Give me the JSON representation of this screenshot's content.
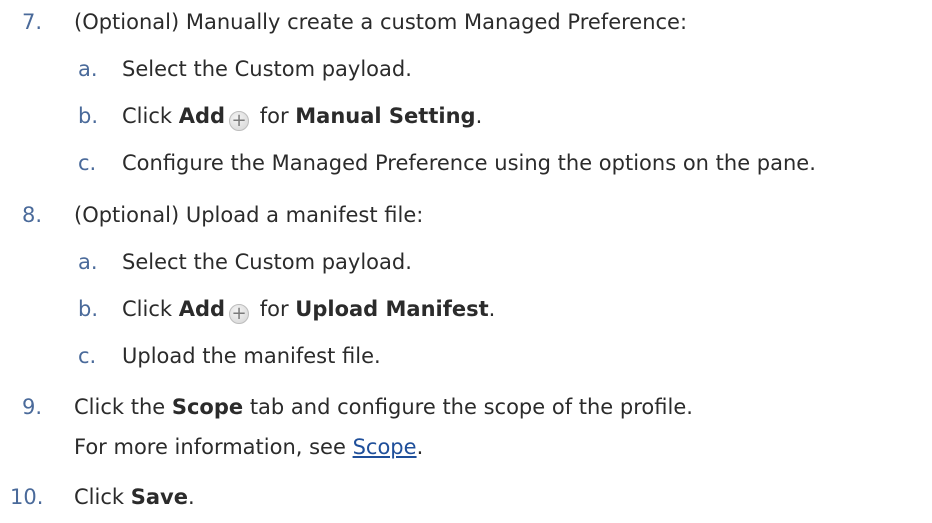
{
  "steps": [
    {
      "num": "7.",
      "text": "(Optional) Manually create a custom Managed Preference:",
      "substeps": [
        {
          "letter": "a.",
          "text": "Select the Custom payload."
        },
        {
          "letter": "b.",
          "pre": "Click ",
          "bold1": "Add",
          "icon": "plus-circle-icon",
          "mid": " for ",
          "bold2": "Manual Setting",
          "post": "."
        },
        {
          "letter": "c.",
          "text": "Configure the Managed Preference using the options on the pane."
        }
      ]
    },
    {
      "num": "8.",
      "text": "(Optional) Upload a manifest file:",
      "substeps": [
        {
          "letter": "a.",
          "text": "Select the Custom payload."
        },
        {
          "letter": "b.",
          "pre": "Click ",
          "bold1": "Add",
          "icon": "plus-circle-icon",
          "mid": " for ",
          "bold2": "Upload Manifest",
          "post": "."
        },
        {
          "letter": "c.",
          "text": "Upload the manifest file."
        }
      ]
    },
    {
      "num": "9.",
      "pre": "Click the ",
      "bold": "Scope",
      "post": " tab and configure the scope of the profile.",
      "note_pre": "For more information, see ",
      "note_link": "Scope",
      "note_post": "."
    },
    {
      "num": "10.",
      "pre": "Click ",
      "bold": "Save",
      "post": "."
    }
  ],
  "icons": {
    "plus": "+"
  },
  "colors": {
    "number": "#4a6a9a",
    "link": "#1f4f9a",
    "text": "#2b2b2b"
  }
}
